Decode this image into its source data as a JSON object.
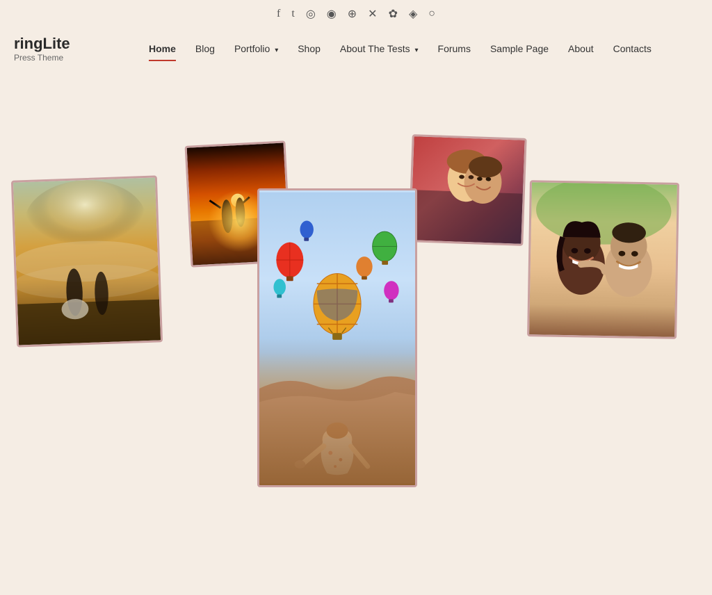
{
  "site": {
    "title": "ringLite",
    "subtitle": "Press Theme"
  },
  "social": {
    "icons": [
      {
        "name": "facebook-icon",
        "symbol": "f"
      },
      {
        "name": "twitter-icon",
        "symbol": "𝕏"
      },
      {
        "name": "instagram-icon",
        "symbol": "◎"
      },
      {
        "name": "rss-icon",
        "symbol": "◉"
      },
      {
        "name": "reddit-icon",
        "symbol": "⊕"
      },
      {
        "name": "xing-icon",
        "symbol": "✕"
      },
      {
        "name": "puzzle-icon",
        "symbol": "✿"
      },
      {
        "name": "wechat-icon",
        "symbol": "◈"
      },
      {
        "name": "person-icon",
        "symbol": "◯"
      }
    ]
  },
  "nav": {
    "items": [
      {
        "label": "Home",
        "active": true,
        "has_dropdown": false
      },
      {
        "label": "Blog",
        "active": false,
        "has_dropdown": false
      },
      {
        "label": "Portfolio",
        "active": false,
        "has_dropdown": true
      },
      {
        "label": "Shop",
        "active": false,
        "has_dropdown": false
      },
      {
        "label": "About The Tests",
        "active": false,
        "has_dropdown": true
      },
      {
        "label": "Forums",
        "active": false,
        "has_dropdown": false
      },
      {
        "label": "Sample Page",
        "active": false,
        "has_dropdown": false
      },
      {
        "label": "About",
        "active": false,
        "has_dropdown": false
      },
      {
        "label": "Contacts",
        "active": false,
        "has_dropdown": false
      }
    ]
  },
  "photos": {
    "card1_alt": "Wedding couple in misty landscape",
    "card2_alt": "Silhouette couple at sunset",
    "card3_alt": "Woman watching hot air balloons",
    "card4_alt": "Couple hugging outdoors",
    "card5_alt": "Smiling couple portrait"
  }
}
